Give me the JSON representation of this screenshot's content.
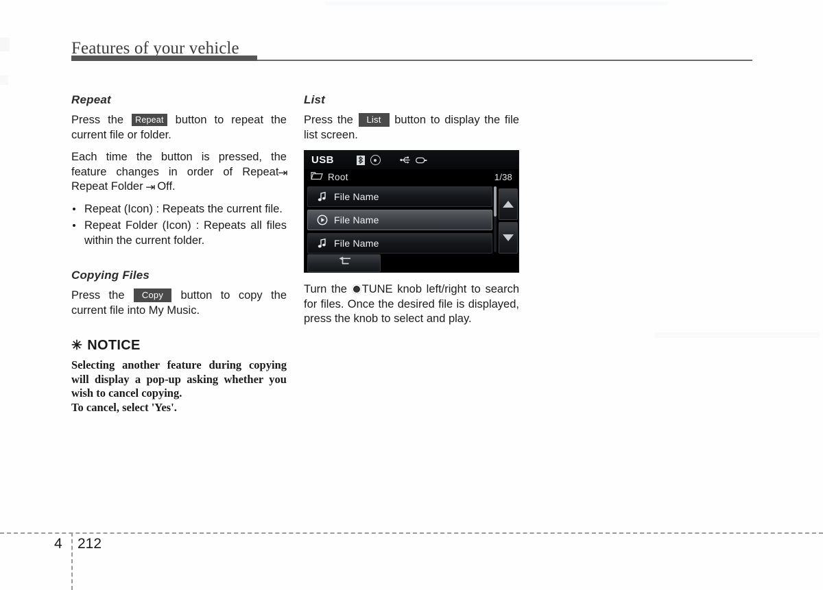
{
  "header": {
    "running_head": "Features of your vehicle"
  },
  "left_column": {
    "repeat": {
      "heading": "Repeat",
      "para1_before": "Press the",
      "keycap": "Repeat",
      "para1_after": "button to repeat the current file or folder.",
      "para2_before": "Each time the button is pressed, the feature changes in order of Repeat",
      "arrow1": "⇥",
      "para2_mid": "Repeat Folder",
      "arrow2": "⇥",
      "para2_after": "Off.",
      "bullets": [
        "Repeat (Icon) : Repeats the current file.",
        "Repeat Folder (Icon) : Repeats all files within the current folder."
      ]
    },
    "copying": {
      "heading": "Copying Files",
      "para_before": "Press the",
      "keycap": "Copy",
      "para_after": "button to copy the current file into My Music."
    },
    "notice": {
      "star": "✳",
      "heading": "NOTICE",
      "line1": "Selecting another feature during copying will display a pop-up asking whether you wish to cancel copying.",
      "line2": "To cancel, select 'Yes'."
    }
  },
  "right_column": {
    "list": {
      "heading": "List",
      "para_before": "Press the",
      "keycap": "List",
      "para_after": "button to display the file list screen."
    },
    "tune": {
      "para_before": "Turn the",
      "knob_icon": "tune-knob-icon",
      "para_after": "TUNE knob left/right to search for files. Once the desired file is displayed, press the knob to select and play."
    }
  },
  "head_unit": {
    "title": "USB",
    "status_icons": [
      "bluetooth-icon",
      "disc-icon",
      "usb-icon",
      "usb-plug-icon"
    ],
    "path_icon": "folder-icon",
    "path": "Root",
    "count": "1/38",
    "rows": [
      {
        "icon": "music-note-icon",
        "label": "File Name",
        "selected": false
      },
      {
        "icon": "play-circle-icon",
        "label": "File Name",
        "selected": true
      },
      {
        "icon": "music-note-icon",
        "label": "File Name",
        "selected": false
      }
    ],
    "scroll_up_label": "scroll-up",
    "scroll_down_label": "scroll-down",
    "back_icon": "back-arrow-icon"
  },
  "footer": {
    "chapter": "4",
    "page": "212"
  },
  "colors": {
    "rule_thick": "#565656",
    "rule_thin": "#6a6a6a",
    "keycap_bg": "#4a4a4a",
    "screen_bg": "#000000",
    "row_selected": "#50545a",
    "text": "#1c1c1c"
  }
}
